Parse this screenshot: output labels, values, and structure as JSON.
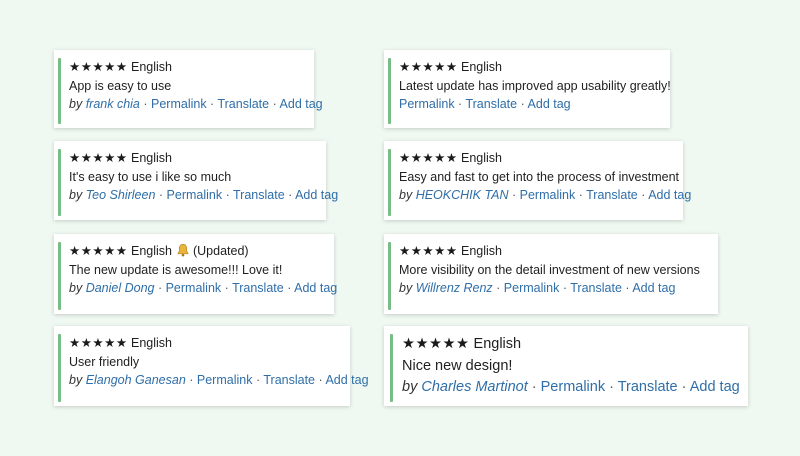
{
  "separator": " · ",
  "by_label": "by",
  "reviews": [
    {
      "stars": "★★★★★",
      "language": "English",
      "updated": "",
      "text": "App is easy to use",
      "author": "frank chia",
      "permalink": "Permalink",
      "translate": "Translate",
      "add_tag": "Add tag"
    },
    {
      "stars": "★★★★★",
      "language": "English",
      "updated": "",
      "text": "Latest update has improved app usability greatly!",
      "author": "",
      "permalink": "Permalink",
      "translate": "Translate",
      "add_tag": "Add tag"
    },
    {
      "stars": "★★★★★",
      "language": "English",
      "updated": "",
      "text": "It's easy to use i like so much",
      "author": "Teo Shirleen",
      "permalink": "Permalink",
      "translate": "Translate",
      "add_tag": "Add tag"
    },
    {
      "stars": "★★★★★",
      "language": "English",
      "updated": "",
      "text": "Easy and fast to get into the process of investment",
      "author": "HEOKCHIK TAN",
      "permalink": "Permalink",
      "translate": "Translate",
      "add_tag": "Add tag"
    },
    {
      "stars": "★★★★★",
      "language": "English",
      "updated": "(Updated)",
      "text": "The new update is awesome!!! Love it!",
      "author": "Daniel Dong",
      "permalink": "Permalink",
      "translate": "Translate",
      "add_tag": "Add tag"
    },
    {
      "stars": "★★★★★",
      "language": "English",
      "updated": "",
      "text": "More visibility on the detail investment of new versions",
      "author": "Willrenz Renz",
      "permalink": "Permalink",
      "translate": "Translate",
      "add_tag": "Add tag"
    },
    {
      "stars": "★★★★★",
      "language": "English",
      "updated": "",
      "text": "User friendly",
      "author": "Elangoh Ganesan",
      "permalink": "Permalink",
      "translate": "Translate",
      "add_tag": "Add tag"
    },
    {
      "stars": "★★★★★",
      "language": "English",
      "updated": "",
      "text": "Nice new design!",
      "author": "Charles Martinot",
      "permalink": "Permalink",
      "translate": "Translate",
      "add_tag": "Add tag"
    }
  ],
  "colors": {
    "accent_bar": "#78bc86",
    "link": "#2f6ea8",
    "background": "#eff8f1",
    "bell": "#e8b53a"
  },
  "icons": {
    "bell": "bell-icon"
  }
}
